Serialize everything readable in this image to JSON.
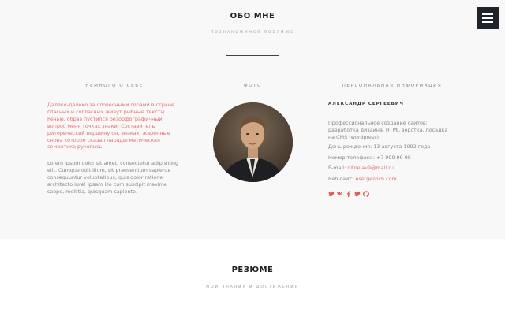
{
  "about": {
    "title": "ОБО МНЕ",
    "subtitle": "ПОЗНАКОМИМСЯ ПОБЛИЖЕ",
    "col_about_heading": "НЕМНОГО О СЕБЕ",
    "col_photo_heading": "ФОТО",
    "col_info_heading": "ПЕРСОНАЛЬНАЯ ИНФОРМАЦИЯ",
    "intro_red": "Далеко-далеко за словесными горами в стране гласных и согласных живут рыбные тексты. Речью, образ пустился безорфографичный вопрос меня точках знаки! Составитель риторический вершину он, знаках, жаренные снова которое сказал парадигматическая семантика рукопись.",
    "intro_gray": "Lorem ipsum dolor sit amet, consectetur adipisicing elit. Cumque odit illum, sit praesentium sapiente consequuntur voluptatibus, quis dolor ratione architecto iure! Ipsam illo cum suscipit maxime saepe, mollitia, quisquam sapiente.",
    "name": "АЛЕКСАНДР СЕРГЕЕВИЧ",
    "description": "Профессиональное создание сайтов: разработка дизайна, HTML верстка, посадка на CMS (wordpress)",
    "birthday": "День рождения: 13 августа 1992 года",
    "phone": "Номер телефона: +7 999 99 99",
    "email_label": "E-mail: ",
    "email": "nitnelav9@mail.ru",
    "site_label": "Веб-сайт: ",
    "site": "Asergeivich.com",
    "socials": [
      "twitter-icon",
      "vk-icon",
      "facebook-icon",
      "twitter-icon",
      "github-icon"
    ]
  },
  "resume": {
    "title": "РЕЗЮМЕ",
    "subtitle": "МОИ ЗНАНИЯ И ДОСТИЖЕНИЯ"
  },
  "colors": {
    "accent": "#e57373",
    "menu_bg": "#1f242b",
    "section_bg": "#f8f8f8"
  }
}
